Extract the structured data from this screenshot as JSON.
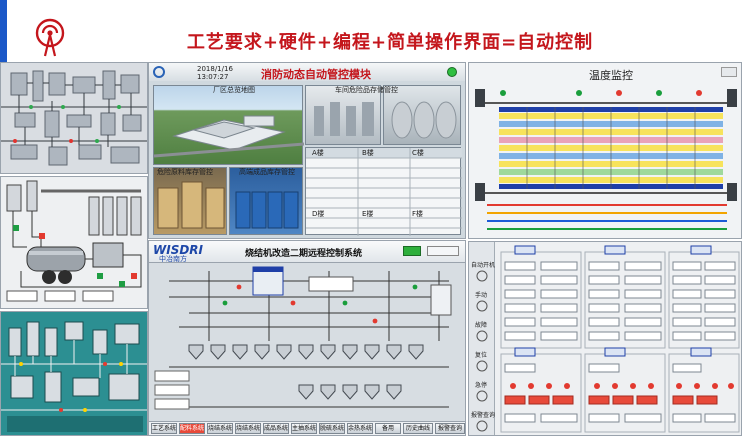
{
  "headline": "工艺要求+硬件+编程+简单操作界面=自动控制",
  "icons": {
    "logo": "antenna-broadcast-icon"
  },
  "colors": {
    "headline_red": "#c4161c",
    "accent_blue": "#1b58c8"
  },
  "fire_panel": {
    "date": "2018/1/16",
    "time": "13:07:27",
    "title": "消防动态自动管控模块",
    "map_title": "厂区总览地图",
    "room_title_1": "车间危险品存储管控",
    "room_title_2": "危险原料库存管控",
    "room_title_3": "高端成品库存管控",
    "cells": [
      "A楼",
      "B楼",
      "C楼",
      "D楼",
      "E楼",
      "F楼"
    ]
  },
  "temp_panel": {
    "title": "温度监控"
  },
  "sinter_panel": {
    "brand": "WISDRI",
    "brand_sub": "中冶南方",
    "title": "烧结机改造二期远程控制系统",
    "tabs": [
      "工艺系统",
      "配料系统",
      "烧结系统",
      "烧结系统",
      "成品系统",
      "主抽系统",
      "脱硫系统",
      "余热系统",
      "备用",
      "历史曲线",
      "报警查询"
    ]
  },
  "ctrl_panel": {
    "side": [
      "自动开机",
      "手动",
      "故障",
      "复位",
      "急停",
      "报警查询"
    ]
  }
}
